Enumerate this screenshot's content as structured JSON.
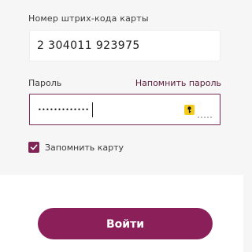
{
  "card": {
    "label": "Номер штрих-кода карты",
    "value": "2 304011 923975"
  },
  "password": {
    "label": "Пароль",
    "forgot_link": "Напомнить пароль",
    "masked_value": "•••••••••••••",
    "autofill_icon": "key-icon"
  },
  "remember": {
    "label": "Запомнить карту",
    "checked": true
  },
  "login_button": {
    "label": "Войти"
  },
  "colors": {
    "accent": "#8b1f59",
    "focus_border": "#7a2b52",
    "autofill_badge": "#f5cc1c"
  }
}
